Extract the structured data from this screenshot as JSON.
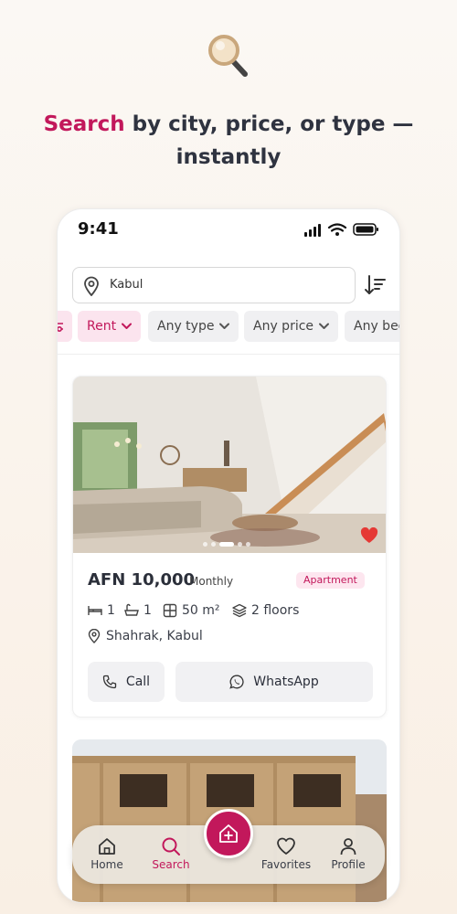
{
  "headline": {
    "accent": "Search",
    "rest": " by city, price, or type —",
    "line2": "instantly"
  },
  "status": {
    "time": "9:41"
  },
  "search": {
    "value": "Kabul"
  },
  "filters": {
    "rent": "Rent",
    "type": "Any type",
    "price": "Any price",
    "beds": "Any beds"
  },
  "listing": {
    "price": "AFN 10,000",
    "period": "Monthly",
    "badge": "Apartment",
    "beds": "1",
    "baths": "1",
    "area": "50 m²",
    "floors": "2 floors",
    "location": "Shahrak, Kabul",
    "favorited": true,
    "photo_index": 3,
    "photo_count": 5
  },
  "actions": {
    "call": "Call",
    "whatsapp": "WhatsApp"
  },
  "nav": {
    "home": "Home",
    "search": "Search",
    "favorites": "Favorites",
    "profile": "Profile"
  },
  "colors": {
    "accent": "#c2185b",
    "badge_bg": "#fde6ef",
    "heart": "#e53935"
  }
}
